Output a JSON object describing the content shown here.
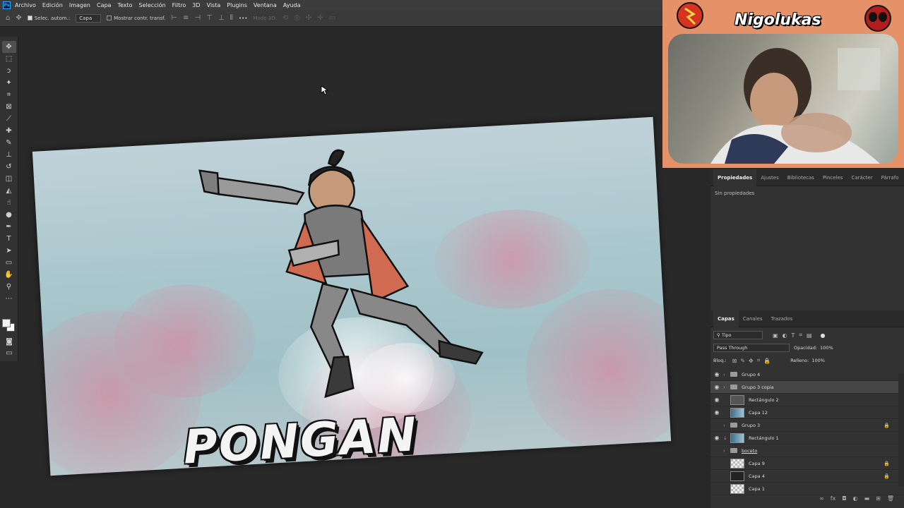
{
  "menubar": {
    "app_icon": "Ps",
    "items": [
      "Archivo",
      "Edición",
      "Imagen",
      "Capa",
      "Texto",
      "Selección",
      "Filtro",
      "3D",
      "Vista",
      "Plugins",
      "Ventana",
      "Ayuda"
    ]
  },
  "options": {
    "auto_select_label": "Selec. autom.:",
    "auto_select_value": "Capa",
    "show_transform_label": "Mostrar contr. transf.",
    "mode_3d_label": "Modo 3D:",
    "more": "•••"
  },
  "canvas": {
    "title_text": "PONGAN BACHATA"
  },
  "webcam": {
    "channel_name": "Nigolukas"
  },
  "properties_panel": {
    "tabs": [
      "Propiedades",
      "Ajustes",
      "Bibliotecas",
      "Pinceles",
      "Carácter",
      "Párrafo"
    ],
    "empty_text": "Sin propiedades"
  },
  "layers_panel": {
    "tabs": [
      "Capas",
      "Canales",
      "Trazados"
    ],
    "filter_label": "Tipo",
    "blend_mode": "Pass Through",
    "opacity_label": "Opacidad:",
    "opacity_value": "100%",
    "lock_label": "Bloq.:",
    "fill_label": "Relleno:",
    "fill_value": "100%",
    "layers": [
      {
        "name": "Grupo 4",
        "type": "group",
        "visible": true,
        "locked": false
      },
      {
        "name": "Grupo 3 copia",
        "type": "group",
        "visible": true,
        "locked": false,
        "selected": true
      },
      {
        "name": "Rectángulo 2",
        "type": "shape",
        "visible": true,
        "locked": false
      },
      {
        "name": "Capa 12",
        "type": "image",
        "visible": true,
        "locked": false
      },
      {
        "name": "Grupo 3",
        "type": "group",
        "visible": false,
        "locked": true
      },
      {
        "name": "Rectángulo 1",
        "type": "shape",
        "visible": true,
        "locked": false
      },
      {
        "name": "boceto",
        "type": "group",
        "visible": false,
        "locked": false
      },
      {
        "name": "Capa 9",
        "type": "pixel",
        "visible": false,
        "locked": true
      },
      {
        "name": "Capa 4",
        "type": "pixel",
        "visible": false,
        "locked": true
      },
      {
        "name": "Capa 1",
        "type": "pixel",
        "visible": false,
        "locked": false
      }
    ]
  }
}
